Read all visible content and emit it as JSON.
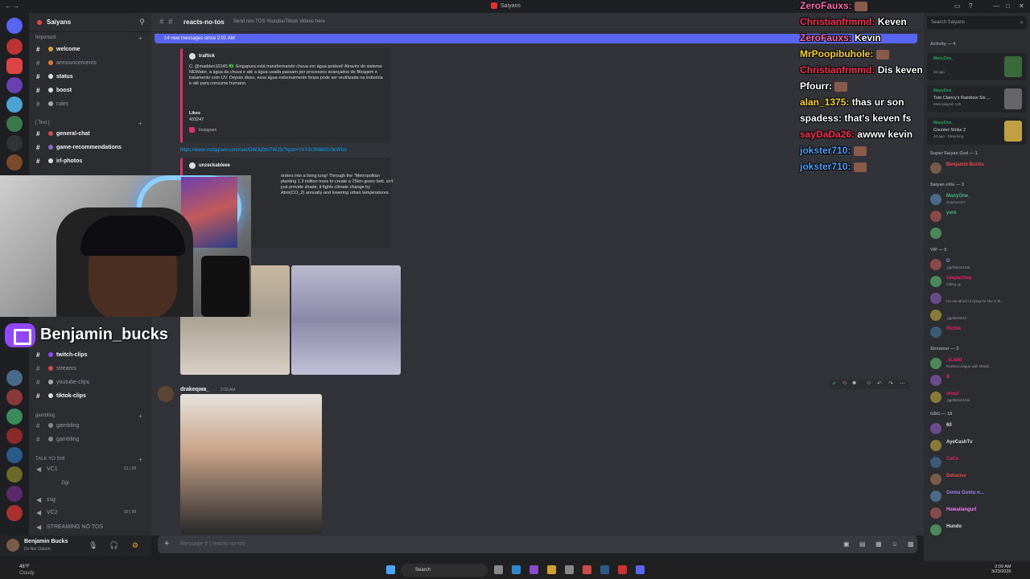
{
  "window": {
    "title": "Saiyans"
  },
  "server": {
    "name": "Saiyans"
  },
  "sidebar": {
    "categories": {
      "important": "Important",
      "text": "[ Text ]",
      "gambling": "gambling",
      "talk": "TALK YO SHI"
    },
    "channels": [
      {
        "label": "welcome",
        "color": "#e0a030",
        "bold": true
      },
      {
        "label": "announcements",
        "color": "#e07a3a",
        "bold": false
      },
      {
        "label": "status",
        "color": "#dddddd",
        "bold": true
      },
      {
        "label": "boost",
        "color": "#dddddd",
        "bold": true
      },
      {
        "label": "rules",
        "color": "#aaaaaa",
        "bold": false
      },
      {
        "label": "general-chat",
        "color": "#d04a4a",
        "bold": true
      },
      {
        "label": "game-recommendations",
        "color": "#8a6ad0",
        "bold": true
      },
      {
        "label": "irl-photos",
        "color": "#dddddd",
        "bold": true
      }
    ],
    "channels2": [
      {
        "label": "twitch-clips",
        "color": "#9146ff",
        "bold": true
      },
      {
        "label": "streams",
        "color": "#d04a4a",
        "bold": false
      },
      {
        "label": "youtube-clips",
        "color": "#aaaaaa",
        "bold": false
      },
      {
        "label": "tiktok-clips",
        "color": "#dddddd",
        "bold": true
      }
    ],
    "gambling_channels": [
      {
        "label": "gambling"
      },
      {
        "label": "gambling"
      }
    ],
    "voice": [
      {
        "label": "VC1",
        "count": "01 | 99"
      },
      {
        "label": "ssg",
        "count": ""
      },
      {
        "label": "VC2",
        "count": "00 | 99"
      },
      {
        "label": "STREAMING NO TOS",
        "count": ""
      }
    ],
    "voice_user": "Zigl",
    "user": {
      "name": "Benjamin Bucks",
      "status": "Do Not Disturb"
    }
  },
  "overlay": {
    "twitch_name": "Benjamin_bucks",
    "chat": [
      {
        "user": "ZeroFauxs:",
        "color": "#ff69b4",
        "msg": ""
      },
      {
        "user": "Christianfrmmd:",
        "color": "#ff2d55",
        "msg": "Keven"
      },
      {
        "user": "ZeroFauxs:",
        "color": "#ff69b4",
        "msg": "Kevin"
      },
      {
        "user": "MrPoopibuhole:",
        "color": "#ffd700",
        "msg": ""
      },
      {
        "user": "Christianfrmmd:",
        "color": "#ff2d55",
        "msg": "Dis keven onggggg"
      },
      {
        "user": "Pfourr:",
        "color": "#ffffff",
        "msg": ""
      },
      {
        "user": "alan_1375:",
        "color": "#ffd700",
        "msg": "thas ur son"
      },
      {
        "user": "spadess:",
        "color": "#ffffff",
        "msg": "that's keven fs"
      },
      {
        "user": "sayDaDa26:",
        "color": "#ff2d55",
        "msg": "awww kevin"
      },
      {
        "user": "jokster710:",
        "color": "#4aa3ff",
        "msg": ""
      },
      {
        "user": "jokster710:",
        "color": "#4aa3ff",
        "msg": ""
      }
    ]
  },
  "main": {
    "channel": "reacts-no-tos",
    "topic": "Send non TOS Youtube/Tiktok Videos here",
    "new_messages": "14 new messages since 2:01 AM",
    "embed1": {
      "author": "traftick",
      "desc": "C: @madden10145 🇧🇷 Singapura está transformando chuva em água potável! Através do sistema NEWater, a água da chuva e até a água usada passam por processos avançados de filtragem e tratamento com UV. Depois disso, essa água extremamente limpa pode ser reutilizada na indústria e até para consumo humano.",
      "field_name": "Likes",
      "field_value": "433247",
      "footer": "Instagram"
    },
    "link": "https://www.instagram.com/reel/DWJqDtuTWJS/?igsh=YXY3c3h6M3U3cWNs",
    "embed2": {
      "author": "unzeckableee",
      "desc": "orders into a living lung! Through the \"Metropolitan planting 1.3 million trees to create a 75km green belt. sn't just provide shade; it fights climate change by Abm(CO_2) annually and lowering urban temperatures."
    },
    "message": {
      "author": "drakeqwa_",
      "time": "2:08 AM"
    },
    "composer_placeholder": "Message #  |  reacts-no-tos"
  },
  "members": {
    "search_placeholder": "Search Saiyans",
    "activity_header": "Activity — 4",
    "activities": [
      {
        "user": "ManyOne_",
        "title": "",
        "sub": "3d ago"
      },
      {
        "user": "ManyOne_",
        "title": "Tom Clancy's Rainbow Six ...",
        "sub": "Most played: 14h"
      },
      {
        "user": "ManyOne_",
        "title": "Counter-Strike 2",
        "sub": "4d ago · Returning"
      }
    ],
    "groups": [
      {
        "header": "Super Saiyan God — 1",
        "members": [
          {
            "name": "Benjamin Bucks",
            "color": "#f04747",
            "sub": ""
          }
        ]
      },
      {
        "header": "Saiyan elite — 3",
        "members": [
          {
            "name": "ManyOne_",
            "color": "#43b581",
            "sub": "Guymoron?"
          },
          {
            "name": "yurk",
            "color": "#43b581",
            "sub": ""
          },
          {
            "name": "",
            "color": "#43b581",
            "sub": ""
          }
        ]
      },
      {
        "header": "VIP — 5",
        "members": [
          {
            "name": "D",
            "color": "#9b84ee",
            "sub": ".gg/district10al"
          },
          {
            "name": "keepachop",
            "color": "#e91e63",
            "sub": "rolling up"
          },
          {
            "name": "",
            "color": "#e91e63",
            "sub": "I'm not afraid of dying for she is th..."
          },
          {
            "name": "",
            "color": "#e91e63",
            "sub": ".gg/district10"
          },
          {
            "name": "Richie",
            "color": "#e91e63",
            "sub": ""
          }
        ]
      },
      {
        "header": "Streamer — 3",
        "members": [
          {
            "name": ".vLadd",
            "color": "#e91e63",
            "sub": "Rocket League with Medal"
          },
          {
            "name": "B",
            "color": "#e91e63",
            "sub": ""
          },
          {
            "name": "oneal",
            "color": "#e91e63",
            "sub": ".gg/district10al"
          }
        ]
      },
      {
        "header": "GBG — 18",
        "members": [
          {
            "name": "60",
            "color": "#dbdee1",
            "sub": ""
          },
          {
            "name": "AyeCashTv",
            "color": "#dbdee1",
            "sub": ""
          },
          {
            "name": "CeCe",
            "color": "#e91e63",
            "sub": ""
          },
          {
            "name": "Delusive",
            "color": "#f04747",
            "sub": ""
          },
          {
            "name": "Gomu Gomu n...",
            "color": "#9b84ee",
            "sub": ""
          },
          {
            "name": "Hawaiiangurl",
            "color": "#f47fff",
            "sub": ""
          },
          {
            "name": "Hundo",
            "color": "#dbdee1",
            "sub": ""
          }
        ]
      }
    ]
  },
  "taskbar": {
    "weather_temp": "48°F",
    "weather_desc": "Cloudy",
    "search": "Search",
    "time": "2:09 AM",
    "date": "3/23/2026"
  }
}
